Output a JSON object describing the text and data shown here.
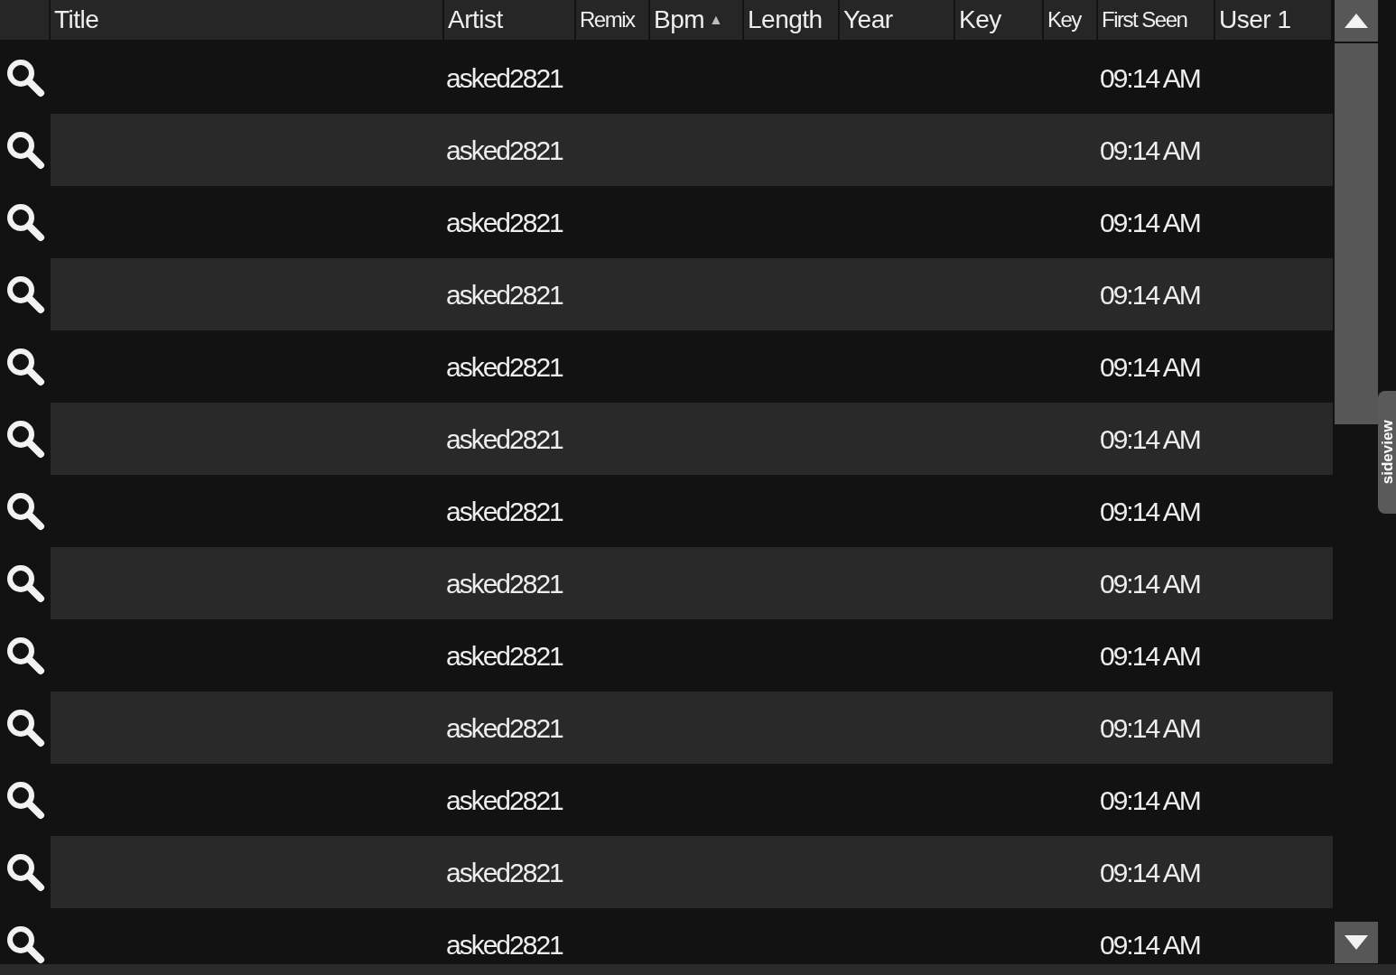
{
  "table": {
    "columns": [
      {
        "label": "Title"
      },
      {
        "label": "Artist"
      },
      {
        "label": "Remix"
      },
      {
        "label": "Bpm",
        "sort_mark": "▲"
      },
      {
        "label": "Length"
      },
      {
        "label": "Year"
      },
      {
        "label": "Key"
      },
      {
        "label": "Key"
      },
      {
        "label": "First Seen"
      },
      {
        "label": "User 1"
      }
    ],
    "rows": [
      {
        "artist": "asked2821",
        "first_seen": "09:14 AM"
      },
      {
        "artist": "asked2821",
        "first_seen": "09:14 AM"
      },
      {
        "artist": "asked2821",
        "first_seen": "09:14 AM"
      },
      {
        "artist": "asked2821",
        "first_seen": "09:14 AM"
      },
      {
        "artist": "asked2821",
        "first_seen": "09:14 AM"
      },
      {
        "artist": "asked2821",
        "first_seen": "09:14 AM"
      },
      {
        "artist": "asked2821",
        "first_seen": "09:14 AM"
      },
      {
        "artist": "asked2821",
        "first_seen": "09:14 AM"
      },
      {
        "artist": "asked2821",
        "first_seen": "09:14 AM"
      },
      {
        "artist": "asked2821",
        "first_seen": "09:14 AM"
      },
      {
        "artist": "asked2821",
        "first_seen": "09:14 AM"
      },
      {
        "artist": "asked2821",
        "first_seen": "09:14 AM"
      },
      {
        "artist": "asked2821",
        "first_seen": "09:14 AM"
      }
    ]
  },
  "side_tab": {
    "label": "sideview"
  }
}
